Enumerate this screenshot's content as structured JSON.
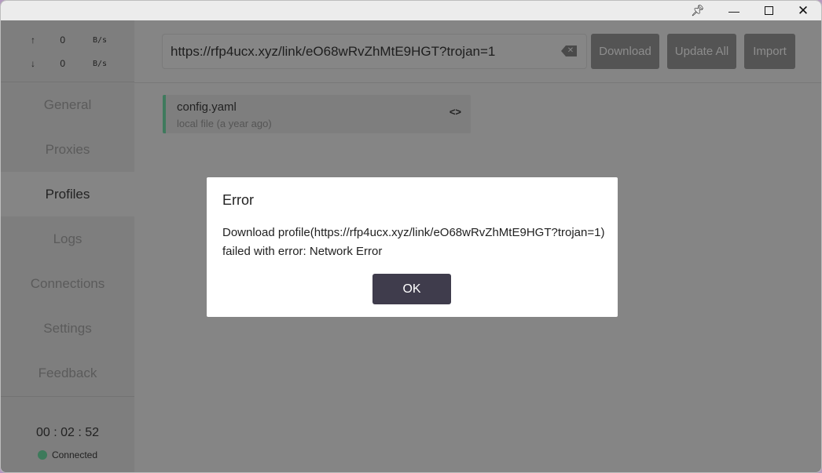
{
  "window": {
    "pin_icon": "pin-icon",
    "minimize_icon": "minimize-icon",
    "maximize_icon": "maximize-icon",
    "close_icon": "close-icon"
  },
  "traffic": {
    "up_arrow": "↑",
    "up_value": "0",
    "up_unit": "B/s",
    "down_arrow": "↓",
    "down_value": "0",
    "down_unit": "B/s"
  },
  "sidebar": {
    "items": [
      {
        "label": "General"
      },
      {
        "label": "Proxies"
      },
      {
        "label": "Profiles"
      },
      {
        "label": "Logs"
      },
      {
        "label": "Connections"
      },
      {
        "label": "Settings"
      },
      {
        "label": "Feedback"
      }
    ],
    "active": "Profiles"
  },
  "footer": {
    "timer": "00 : 02 : 52",
    "status": "Connected",
    "status_color": "#3d7a5b"
  },
  "toolbar": {
    "url_value": "https://rfp4ucx.xyz/link/eO68wRvZhMtE9HGT?trojan=1",
    "download": "Download",
    "update_all": "Update All",
    "import": "Import"
  },
  "profiles": [
    {
      "name": "config.yaml",
      "meta": "local file (a year ago)",
      "accent": "#3f7a5d"
    }
  ],
  "dialog": {
    "title": "Error",
    "message": "Download profile(https://rfp4ucx.xyz/link/eO68wRvZhMtE9HGT?trojan=1) failed with error: Network Error",
    "ok": "OK"
  }
}
